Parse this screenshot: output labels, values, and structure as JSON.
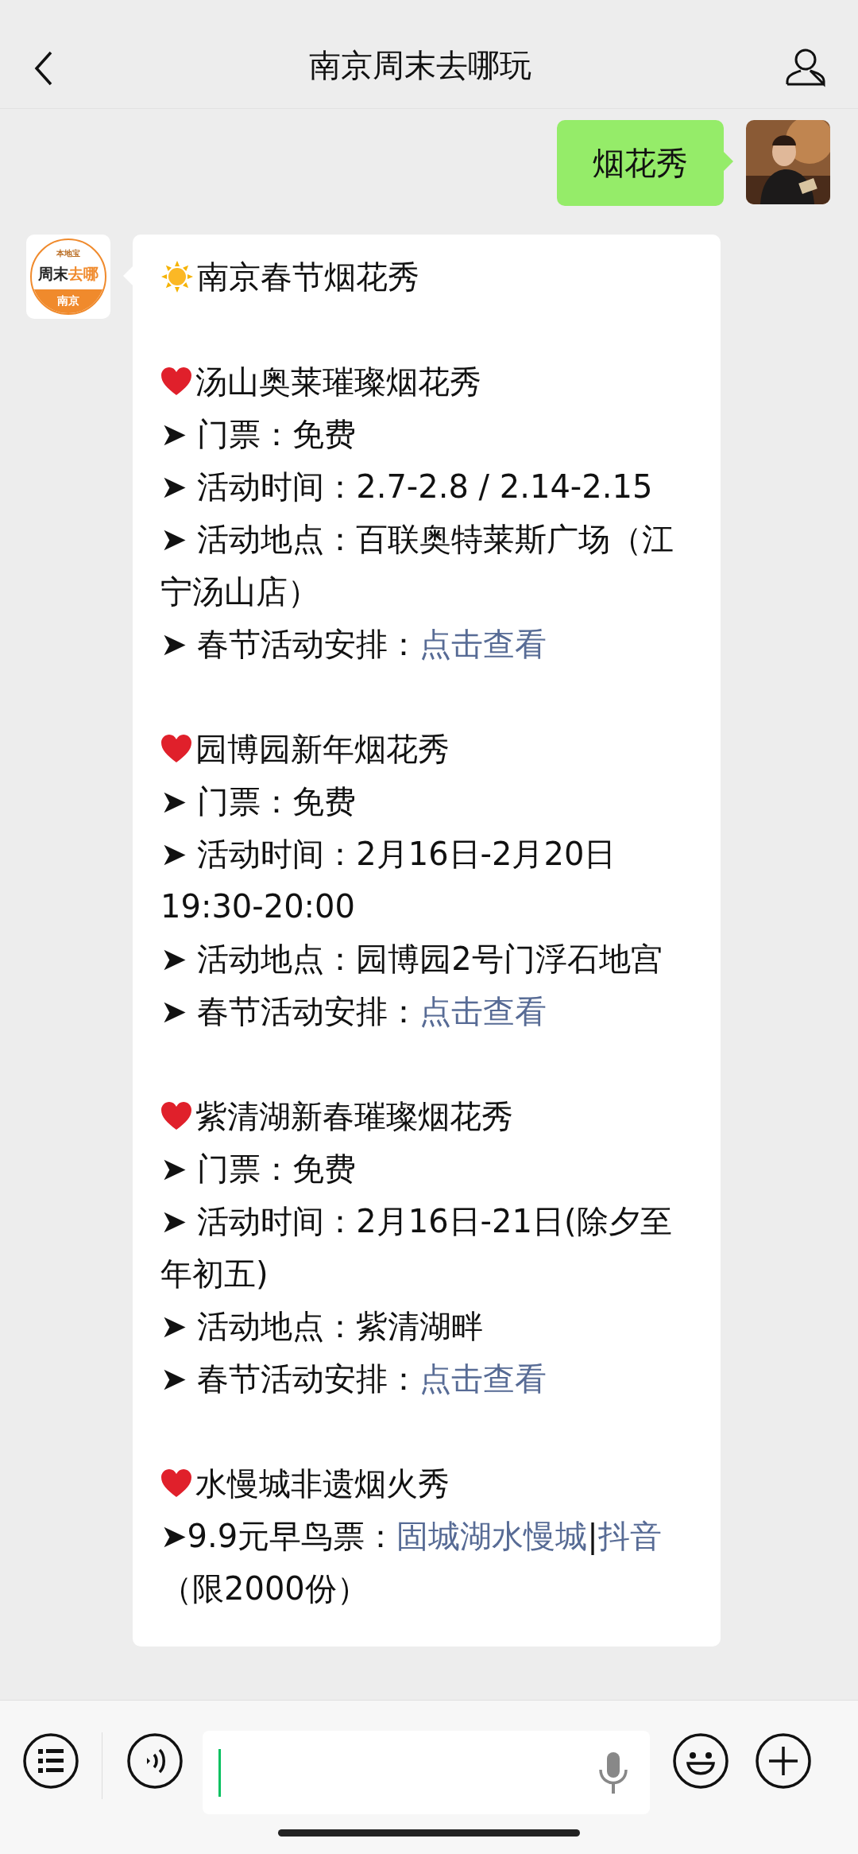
{
  "header": {
    "title": "南京周末去哪玩"
  },
  "sent_message": {
    "text": "烟花秀"
  },
  "bot": {
    "logo": {
      "top": "本地宝",
      "middle": [
        "周末",
        "去哪"
      ],
      "bottom": "南京"
    }
  },
  "reply": {
    "heading": {
      "text": "南京春节烟花秀"
    },
    "sections": [
      {
        "title": "汤山奥莱璀璨烟花秀",
        "lines": [
          [
            {
              "kind": "text",
              "text": "➤ 门票：免费"
            }
          ],
          [
            {
              "kind": "text",
              "text": "➤ 活动时间：2.7-2.8 / 2.14-2.15"
            }
          ],
          [
            {
              "kind": "text",
              "text": "➤ 活动地点：百联奥特莱斯广场（江宁汤山店）"
            }
          ],
          [
            {
              "kind": "text",
              "text": "➤ 春节活动安排："
            },
            {
              "kind": "link",
              "text": "点击查看"
            }
          ]
        ]
      },
      {
        "title": "园博园新年烟花秀",
        "lines": [
          [
            {
              "kind": "text",
              "text": "➤ 门票：免费"
            }
          ],
          [
            {
              "kind": "text",
              "text": "➤ 活动时间：2月16日-2月20日 19:30-20:00"
            }
          ],
          [
            {
              "kind": "text",
              "text": "➤ 活动地点：园博园2号门浮石地宫"
            }
          ],
          [
            {
              "kind": "text",
              "text": "➤ 春节活动安排："
            },
            {
              "kind": "link",
              "text": "点击查看"
            }
          ]
        ]
      },
      {
        "title": "紫清湖新春璀璨烟花秀",
        "lines": [
          [
            {
              "kind": "text",
              "text": "➤ 门票：免费"
            }
          ],
          [
            {
              "kind": "text",
              "text": "➤ 活动时间：2月16日-21日(除夕至年初五)"
            }
          ],
          [
            {
              "kind": "text",
              "text": "➤ 活动地点：紫清湖畔"
            }
          ],
          [
            {
              "kind": "text",
              "text": "➤ 春节活动安排："
            },
            {
              "kind": "link",
              "text": "点击查看"
            }
          ]
        ]
      },
      {
        "title": "水慢城非遗烟火秀",
        "lines": [
          [
            {
              "kind": "text",
              "text": "➤9.9元早鸟票："
            },
            {
              "kind": "link",
              "text": "固城湖水慢城"
            },
            {
              "kind": "text",
              "text": "|"
            },
            {
              "kind": "link",
              "text": "抖音"
            },
            {
              "kind": "text",
              "text": "（限2000份）"
            }
          ]
        ]
      }
    ]
  }
}
